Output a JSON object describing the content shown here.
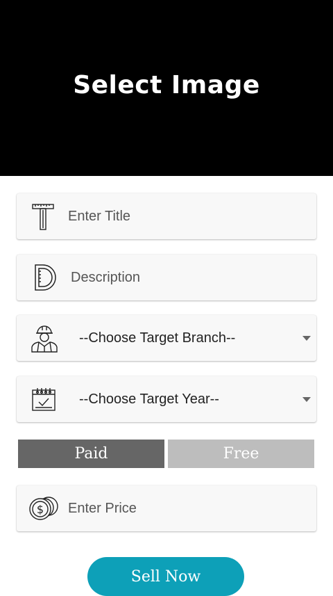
{
  "header": {
    "title": "Select Image"
  },
  "form": {
    "title_placeholder": "Enter Title",
    "description_placeholder": "Description",
    "branch_select": "--Choose Target Branch--",
    "year_select": "--Choose Target Year--",
    "price_placeholder": "Enter Price"
  },
  "pricing_toggle": {
    "paid_label": "Paid",
    "free_label": "Free",
    "selected": "Paid"
  },
  "submit": {
    "label": "Sell Now"
  },
  "colors": {
    "accent": "#0da0b8",
    "header_bg": "#000000",
    "toggle_active": "#666666",
    "toggle_inactive": "#bdbdbd"
  },
  "icons": [
    "title-t-icon",
    "description-d-icon",
    "engineer-icon",
    "calendar-icon",
    "coins-icon"
  ]
}
